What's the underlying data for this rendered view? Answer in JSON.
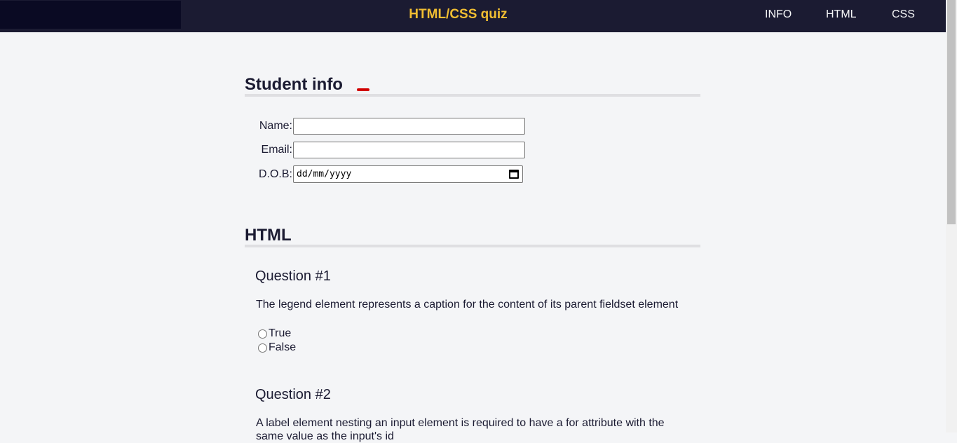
{
  "header": {
    "title": "HTML/CSS quiz",
    "nav": [
      "INFO",
      "HTML",
      "CSS"
    ]
  },
  "student_info": {
    "heading": "Student info",
    "name_label": "Name:",
    "email_label": "Email:",
    "dob_label": "D.O.B:",
    "dob_placeholder": "dd/mm/yyyy"
  },
  "html_section": {
    "heading": "HTML",
    "questions": [
      {
        "title": "Question #1",
        "text": "The legend element represents a caption for the content of its parent fieldset element",
        "options": [
          "True",
          "False"
        ]
      },
      {
        "title": "Question #2",
        "text": "A label element nesting an input element is required to have a for attribute with the same value as the input's id"
      }
    ]
  },
  "colors": {
    "header_bg": "#1b1b32",
    "title_accent": "#f1be32",
    "page_bg": "#f4f5f7"
  }
}
